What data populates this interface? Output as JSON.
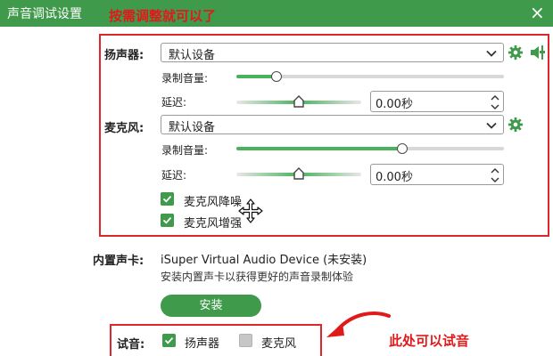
{
  "window": {
    "title": "声音调试设置",
    "close_glyph": "×"
  },
  "annotations": {
    "top_text": "按需调整就可以了",
    "bottom_text": "此处可以试音"
  },
  "speaker": {
    "label": "扬声器:",
    "device": "默认设备",
    "volume_label": "录制音量:",
    "volume_level": 0.15,
    "delay_label": "延迟:",
    "delay_value": "0.00秒",
    "icons": [
      "gear-icon",
      "speaker-settings-icon"
    ]
  },
  "microphone": {
    "label": "麦克风:",
    "device": "默认设备",
    "volume_label": "录制音量:",
    "volume_level": 0.62,
    "delay_label": "延迟:",
    "delay_value": "0.00秒",
    "noise_reduction_label": "麦克风降噪",
    "noise_reduction_checked": true,
    "enhance_label": "麦克风增强",
    "enhance_checked": true
  },
  "builtin_card": {
    "label": "内置声卡:",
    "device": "iSuper Virtual Audio Device (未安装)",
    "hint": "安装内置声卡以获得更好的声音录制体验",
    "install_label": "安装"
  },
  "test": {
    "label": "试音:",
    "speaker_label": "扬声器",
    "speaker_checked": true,
    "mic_label": "麦克风",
    "mic_checked": false
  },
  "colors": {
    "accent": "#3f9a4b",
    "slider_fill": "#49b25c",
    "annotation_red": "#e01a1a"
  }
}
